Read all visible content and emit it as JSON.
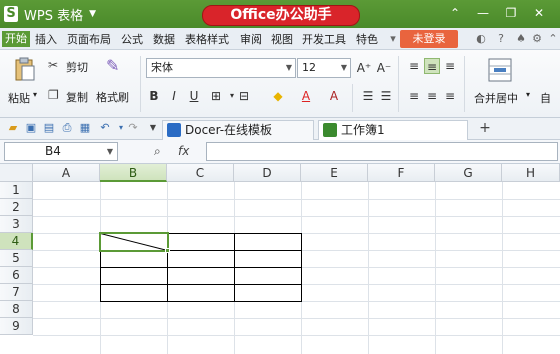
{
  "title_bar": {
    "app_name": "WPS 表格",
    "logo_letter": "S",
    "banner": "Office办公助手",
    "controls": [
      "⌃",
      "—",
      "❐",
      "✕"
    ]
  },
  "menu": {
    "items": [
      "开始",
      "插入",
      "页面布局",
      "公式",
      "数据",
      "表格样式",
      "审阅",
      "视图",
      "开发工具",
      "特色"
    ],
    "active_index": 0,
    "login_label": "未登录",
    "right_icons": [
      "skin-icon",
      "help-icon",
      "shirt-icon",
      "settings-icon",
      "minimize-ribbon-icon"
    ]
  },
  "ribbon": {
    "paste_label": "粘贴",
    "cut_label": "剪切",
    "copy_label": "复制",
    "format_painter_label": "格式刷",
    "font_name": "宋体",
    "font_size": "12",
    "bold": "B",
    "italic": "I",
    "underline": "U",
    "merge_label": "合并居中",
    "wrap_label": "自"
  },
  "tabs": {
    "items": [
      {
        "label": "Docer-在线模板",
        "icon": "docer-icon"
      },
      {
        "label": "工作簿1",
        "icon": "workbook-icon"
      }
    ],
    "active_index": 1,
    "add_label": "+"
  },
  "formula_bar": {
    "cell_ref": "B4",
    "fx_label": "fx",
    "formula_value": ""
  },
  "grid": {
    "columns": [
      "A",
      "B",
      "C",
      "D",
      "E",
      "F",
      "G",
      "H"
    ],
    "rows": [
      "1",
      "2",
      "3",
      "4",
      "5",
      "6",
      "7",
      "8",
      "9"
    ],
    "selected_column": "B",
    "selected_row": "4"
  },
  "colors": {
    "accent": "#5b9a36",
    "banner_red": "#d9242a",
    "login_orange": "#e9643e"
  }
}
